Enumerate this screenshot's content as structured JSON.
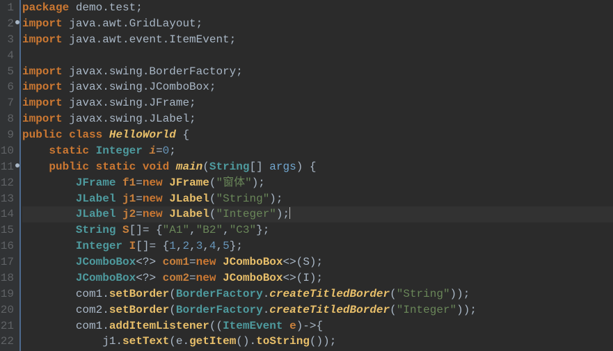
{
  "gutter": {
    "lines": [
      "1",
      "2",
      "3",
      "4",
      "5",
      "6",
      "7",
      "8",
      "9",
      "10",
      "11",
      "12",
      "13",
      "14",
      "15",
      "16",
      "17",
      "18",
      "19",
      "20",
      "21",
      "22"
    ],
    "markers": [
      2,
      11
    ]
  },
  "highlightedLine": 14,
  "code": {
    "l1": {
      "kw_package": "package",
      "pkg": " demo.test;"
    },
    "l2": {
      "kw_import": "import",
      "pkg": " java.awt.GridLayout;"
    },
    "l3": {
      "kw_import": "import",
      "pkg": " java.awt.event.ItemEvent;"
    },
    "l5": {
      "kw_import": "import",
      "pkg": " javax.swing.BorderFactory;"
    },
    "l6": {
      "kw_import": "import",
      "pkg": " javax.swing.JComboBox;"
    },
    "l7": {
      "kw_import": "import",
      "pkg": " javax.swing.JFrame;"
    },
    "l8": {
      "kw_import": "import",
      "pkg": " javax.swing.JLabel;"
    },
    "l9": {
      "kw_public": "public",
      "kw_class": "class",
      "name": "HelloWorld",
      "brace": " {"
    },
    "l10": {
      "indent": "    ",
      "kw_static": "static",
      "type": "Integer",
      "var": "i",
      "eq": "=",
      "num": "0",
      "semi": ";"
    },
    "l11": {
      "indent": "    ",
      "kw_public": "public",
      "kw_static": "static",
      "kw_void": "void",
      "method": "main",
      "lp": "(",
      "ptype": "String",
      "arr": "[] ",
      "pname": "args",
      "rp": ") {"
    },
    "l12": {
      "indent": "        ",
      "type": "JFrame",
      "var": "f1",
      "eq": "=",
      "kw_new": "new",
      "ctor": "JFrame",
      "lp": "(",
      "str": "\"窗体\"",
      "rp": ");"
    },
    "l13": {
      "indent": "        ",
      "type": "JLabel",
      "var": "j1",
      "eq": "=",
      "kw_new": "new",
      "ctor": "JLabel",
      "lp": "(",
      "str": "\"String\"",
      "rp": ");"
    },
    "l14": {
      "indent": "        ",
      "type": "JLabel",
      "var": "j2",
      "eq": "=",
      "kw_new": "new",
      "ctor": "JLabel",
      "lp": "(",
      "str": "\"Integer\"",
      "rp": ");"
    },
    "l15": {
      "indent": "        ",
      "type": "String",
      "var": "S",
      "arr": "[]= {",
      "s1": "\"A1\"",
      "c1": ",",
      "s2": "\"B2\"",
      "c2": ",",
      "s3": "\"C3\"",
      "end": "};"
    },
    "l16": {
      "indent": "        ",
      "type": "Integer",
      "var": "I",
      "arr": "[]= {",
      "n1": "1",
      "c1": ",",
      "n2": "2",
      "c2": ",",
      "n3": "3",
      "c3": ",",
      "n4": "4",
      "c4": ",",
      "n5": "5",
      "end": "};"
    },
    "l17": {
      "indent": "        ",
      "type": "JComboBox",
      "gen": "<?> ",
      "var": "com1",
      "eq": "=",
      "kw_new": "new",
      "ctor": "JComboBox",
      "geno": "<>(",
      "arg": "S",
      "rp": ");"
    },
    "l18": {
      "indent": "        ",
      "type": "JComboBox",
      "gen": "<?> ",
      "var": "com2",
      "eq": "=",
      "kw_new": "new",
      "ctor": "JComboBox",
      "geno": "<>(",
      "arg": "I",
      "rp": ");"
    },
    "l19": {
      "indent": "        ",
      "obj": "com1",
      "dot": ".",
      "m1": "setBorder",
      "lp": "(",
      "cls": "BorderFactory",
      "dot2": ".",
      "m2": "createTitledBorder",
      "lp2": "(",
      "str": "\"String\"",
      "rp": "));"
    },
    "l20": {
      "indent": "        ",
      "obj": "com2",
      "dot": ".",
      "m1": "setBorder",
      "lp": "(",
      "cls": "BorderFactory",
      "dot2": ".",
      "m2": "createTitledBorder",
      "lp2": "(",
      "str": "\"Integer\"",
      "rp": "));"
    },
    "l21": {
      "indent": "        ",
      "obj": "com1",
      "dot": ".",
      "m1": "addItemListener",
      "lp": "((",
      "ptype": "ItemEvent",
      "pname": " e",
      "rp": ")->{",
      "sp": ""
    },
    "l22": {
      "indent": "            ",
      "obj": "j1",
      "dot": ".",
      "m1": "setText",
      "lp": "(",
      "arg": "e",
      "dot2": ".",
      "m2": "getItem",
      "call": "().",
      "m3": "toString",
      "rp": "());"
    }
  }
}
